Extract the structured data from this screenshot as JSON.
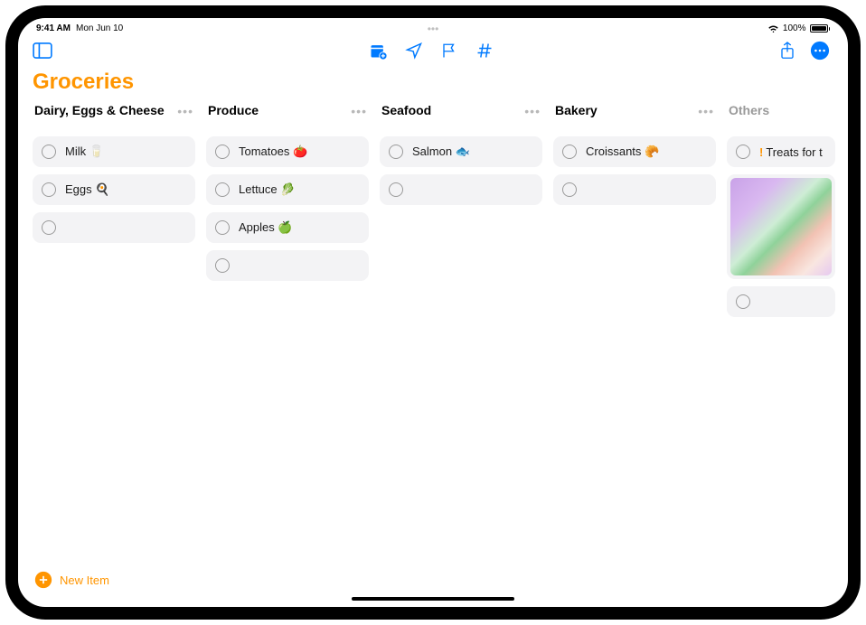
{
  "status_bar": {
    "time": "9:41 AM",
    "date": "Mon Jun 10",
    "battery_percent": "100%"
  },
  "list_title": "Groceries",
  "columns": [
    {
      "title": "Dairy, Eggs & Cheese",
      "items": [
        {
          "label": "Milk 🥛"
        },
        {
          "label": "Eggs 🍳"
        }
      ],
      "empty_rows": 1
    },
    {
      "title": "Produce",
      "items": [
        {
          "label": "Tomatoes 🍅"
        },
        {
          "label": "Lettuce 🥬"
        },
        {
          "label": "Apples 🍏"
        }
      ],
      "empty_rows": 1
    },
    {
      "title": "Seafood",
      "items": [
        {
          "label": "Salmon 🐟"
        }
      ],
      "empty_rows": 1
    },
    {
      "title": "Bakery",
      "items": [
        {
          "label": "Croissants 🥐"
        }
      ],
      "empty_rows": 1
    },
    {
      "title": "Others",
      "inactive": true,
      "items": [
        {
          "label": "Treats for t",
          "priority": "!"
        }
      ],
      "has_image": true,
      "empty_rows": 1
    }
  ],
  "new_item_label": "New Item"
}
